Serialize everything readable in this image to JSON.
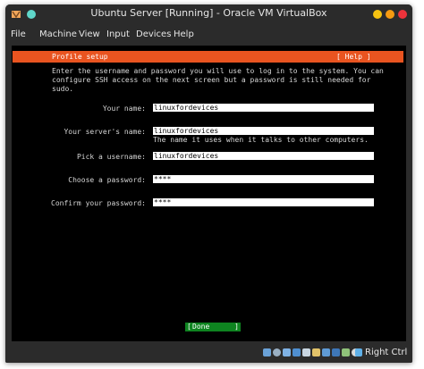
{
  "window": {
    "title": "Ubuntu Server [Running] - Oracle VM VirtualBox"
  },
  "menu": [
    "File",
    "Machine",
    "View",
    "Input",
    "Devices",
    "Help"
  ],
  "installer": {
    "header_title": "Profile setup",
    "help_label": "[ Help ]",
    "accent_color": "#e95420",
    "intro_lines": [
      "Enter the username and password you will use to log in to the system. You can",
      "configure SSH access on the next screen but a password is still needed for",
      "sudo."
    ],
    "fields": [
      {
        "label": "Your name:",
        "value": "linuxfordevices"
      },
      {
        "label": "Your server's name:",
        "value": "linuxfordevices",
        "hint": "The name it uses when it talks to other computers."
      },
      {
        "label": "Pick a username:",
        "value": "linuxfordevices"
      },
      {
        "label": "Choose a password:",
        "value": "****"
      },
      {
        "label": "Confirm your password:",
        "value": "****"
      }
    ],
    "done": {
      "left": "[",
      "label": "Done",
      "right": "]",
      "color": "#0e8420"
    }
  },
  "status": {
    "host_key": "Right Ctrl",
    "icons": [
      "hard-disk-icon",
      "optical-drive-icon",
      "audio-icon",
      "network-icon",
      "usb-icon",
      "shared-folder-icon",
      "display-icon",
      "video-capture-icon",
      "cpu-icon",
      "mouse-integration-icon",
      "keyboard-icon"
    ]
  }
}
